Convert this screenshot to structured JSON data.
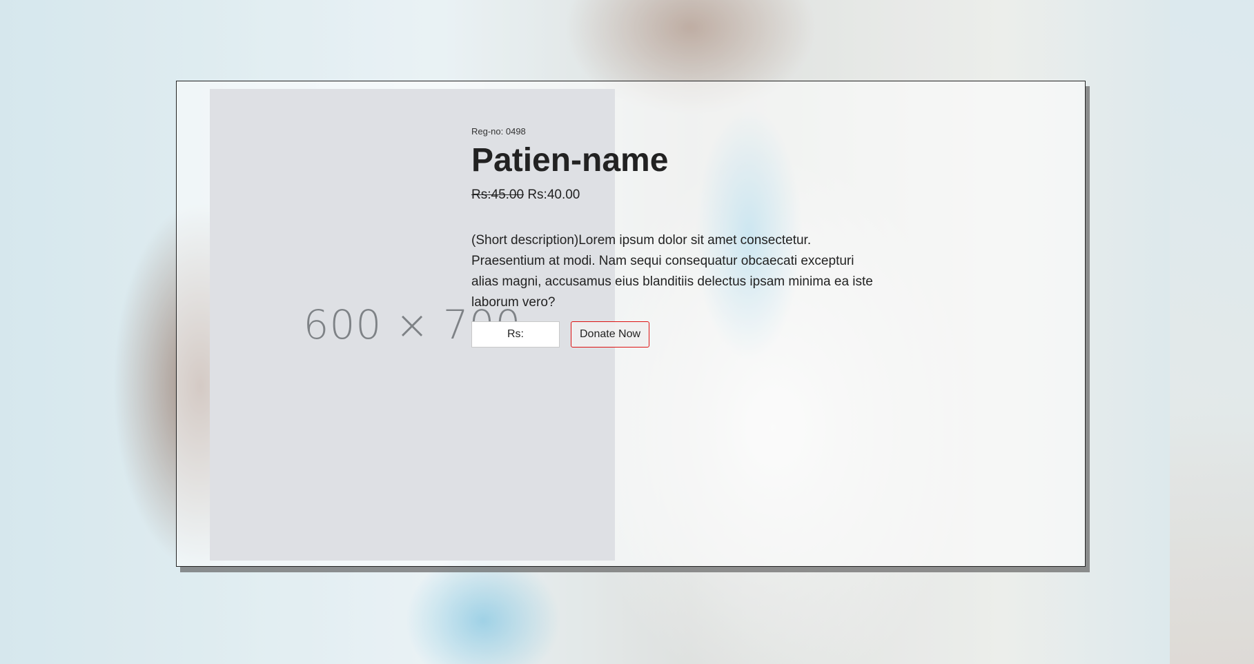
{
  "placeholder": {
    "label": "600 × 700"
  },
  "patient": {
    "reg_no": "Reg-no: 0498",
    "name": "Patien-name",
    "price_old": "Rs:45.00",
    "price_new": "Rs:40.00",
    "description": "(Short description)Lorem ipsum dolor sit amet consectetur. Praesentium at modi. Nam sequi consequatur obcaecati excepturi alias magni, accusamus eius blanditiis delectus ipsam minima ea iste laborum vero?"
  },
  "donation": {
    "amount_placeholder": "Rs:",
    "button_label": "Donate Now"
  },
  "colors": {
    "button_border": "#dd1111",
    "placeholder_bg": "#dee0e4"
  }
}
